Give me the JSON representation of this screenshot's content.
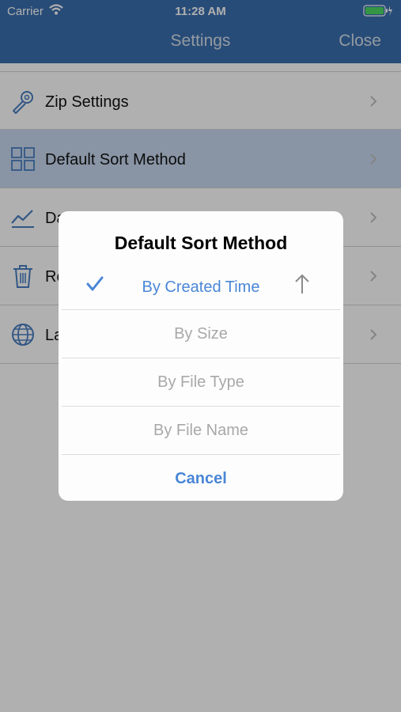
{
  "status_bar": {
    "carrier": "Carrier",
    "time": "11:28 AM"
  },
  "nav": {
    "title": "Settings",
    "close_label": "Close"
  },
  "settings_items": [
    {
      "label": "Zip Settings",
      "icon": "wrench-icon"
    },
    {
      "label": "Default Sort Method",
      "icon": "grid-icon"
    },
    {
      "label": "Da",
      "icon": "chart-icon"
    },
    {
      "label": "Re",
      "icon": "trash-icon"
    },
    {
      "label": "La",
      "icon": "globe-icon"
    }
  ],
  "dialog": {
    "title": "Default Sort Method",
    "options": [
      "By Created Time",
      "By Size",
      "By File Type",
      "By File Name"
    ],
    "selected_option": "By Created Time",
    "sort_direction": "ascending",
    "cancel_label": "Cancel"
  },
  "colors": {
    "nav_bar": "#3a6fae",
    "accent": "#4a86d6",
    "selected_row": "#c7d8ef"
  }
}
